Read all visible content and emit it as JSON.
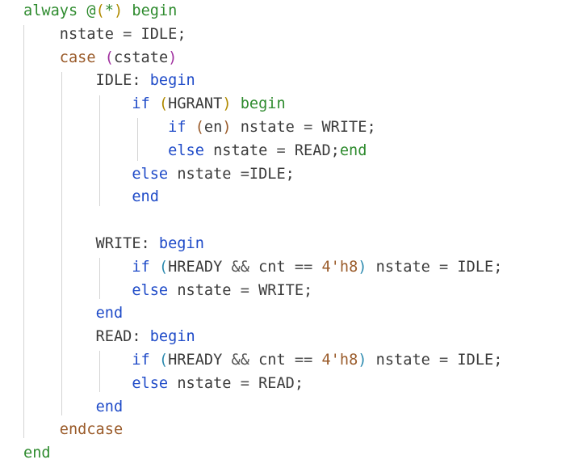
{
  "code": {
    "lines": [
      [
        {
          "t": "always ",
          "c": "kw-green"
        },
        {
          "t": "@",
          "c": "kw-green"
        },
        {
          "t": "(",
          "c": "paren-gold"
        },
        {
          "t": "*",
          "c": "kw-green"
        },
        {
          "t": ")",
          "c": "paren-gold"
        },
        {
          "t": " begin",
          "c": "kw-green"
        }
      ],
      [
        {
          "t": "    nstate ",
          "c": "plain"
        },
        {
          "t": "=",
          "c": "op"
        },
        {
          "t": " IDLE;",
          "c": "plain"
        }
      ],
      [
        {
          "t": "    ",
          "c": "plain"
        },
        {
          "t": "case",
          "c": "kw-brown"
        },
        {
          "t": " ",
          "c": "plain"
        },
        {
          "t": "(",
          "c": "paren-purple"
        },
        {
          "t": "cstate",
          "c": "plain"
        },
        {
          "t": ")",
          "c": "paren-purple"
        }
      ],
      [
        {
          "t": "        IDLE: ",
          "c": "plain"
        },
        {
          "t": "begin",
          "c": "kw-blue"
        }
      ],
      [
        {
          "t": "            ",
          "c": "plain"
        },
        {
          "t": "if",
          "c": "kw-blue"
        },
        {
          "t": " ",
          "c": "plain"
        },
        {
          "t": "(",
          "c": "paren-gold"
        },
        {
          "t": "HGRANT",
          "c": "plain"
        },
        {
          "t": ")",
          "c": "paren-gold"
        },
        {
          "t": " begin",
          "c": "kw-green"
        }
      ],
      [
        {
          "t": "                ",
          "c": "plain"
        },
        {
          "t": "if",
          "c": "kw-blue"
        },
        {
          "t": " ",
          "c": "plain"
        },
        {
          "t": "(",
          "c": "kw-brown"
        },
        {
          "t": "en",
          "c": "plain"
        },
        {
          "t": ")",
          "c": "kw-brown"
        },
        {
          "t": " nstate ",
          "c": "plain"
        },
        {
          "t": "=",
          "c": "op"
        },
        {
          "t": " WRITE;",
          "c": "plain"
        }
      ],
      [
        {
          "t": "                ",
          "c": "plain"
        },
        {
          "t": "else",
          "c": "kw-blue"
        },
        {
          "t": " nstate ",
          "c": "plain"
        },
        {
          "t": "=",
          "c": "op"
        },
        {
          "t": " READ;",
          "c": "plain"
        },
        {
          "t": "end",
          "c": "kw-green"
        }
      ],
      [
        {
          "t": "            ",
          "c": "plain"
        },
        {
          "t": "else",
          "c": "kw-blue"
        },
        {
          "t": " nstate ",
          "c": "plain"
        },
        {
          "t": "=",
          "c": "op"
        },
        {
          "t": "IDLE;",
          "c": "plain"
        }
      ],
      [
        {
          "t": "            ",
          "c": "plain"
        },
        {
          "t": "end",
          "c": "kw-blue"
        }
      ],
      [],
      [
        {
          "t": "        WRITE: ",
          "c": "plain"
        },
        {
          "t": "begin",
          "c": "kw-blue"
        }
      ],
      [
        {
          "t": "            ",
          "c": "plain"
        },
        {
          "t": "if",
          "c": "kw-blue"
        },
        {
          "t": " ",
          "c": "plain"
        },
        {
          "t": "(",
          "c": "paren-teal"
        },
        {
          "t": "HREADY ",
          "c": "plain"
        },
        {
          "t": "&&",
          "c": "op"
        },
        {
          "t": " cnt ",
          "c": "plain"
        },
        {
          "t": "==",
          "c": "op"
        },
        {
          "t": " ",
          "c": "plain"
        },
        {
          "t": "4'h8",
          "c": "num"
        },
        {
          "t": ")",
          "c": "paren-teal"
        },
        {
          "t": " nstate ",
          "c": "plain"
        },
        {
          "t": "=",
          "c": "op"
        },
        {
          "t": " IDLE;",
          "c": "plain"
        }
      ],
      [
        {
          "t": "            ",
          "c": "plain"
        },
        {
          "t": "else",
          "c": "kw-blue"
        },
        {
          "t": " nstate ",
          "c": "plain"
        },
        {
          "t": "=",
          "c": "op"
        },
        {
          "t": " WRITE;",
          "c": "plain"
        }
      ],
      [
        {
          "t": "        ",
          "c": "plain"
        },
        {
          "t": "end",
          "c": "kw-blue"
        }
      ],
      [
        {
          "t": "        READ: ",
          "c": "plain"
        },
        {
          "t": "begin",
          "c": "kw-blue"
        }
      ],
      [
        {
          "t": "            ",
          "c": "plain"
        },
        {
          "t": "if",
          "c": "kw-blue"
        },
        {
          "t": " ",
          "c": "plain"
        },
        {
          "t": "(",
          "c": "paren-teal"
        },
        {
          "t": "HREADY ",
          "c": "plain"
        },
        {
          "t": "&&",
          "c": "op"
        },
        {
          "t": " cnt ",
          "c": "plain"
        },
        {
          "t": "==",
          "c": "op"
        },
        {
          "t": " ",
          "c": "plain"
        },
        {
          "t": "4'h8",
          "c": "num"
        },
        {
          "t": ")",
          "c": "paren-teal"
        },
        {
          "t": " nstate ",
          "c": "plain"
        },
        {
          "t": "=",
          "c": "op"
        },
        {
          "t": " IDLE;",
          "c": "plain"
        }
      ],
      [
        {
          "t": "            ",
          "c": "plain"
        },
        {
          "t": "else",
          "c": "kw-blue"
        },
        {
          "t": " nstate ",
          "c": "plain"
        },
        {
          "t": "=",
          "c": "op"
        },
        {
          "t": " READ;",
          "c": "plain"
        }
      ],
      [
        {
          "t": "        ",
          "c": "plain"
        },
        {
          "t": "end",
          "c": "kw-blue"
        }
      ],
      [
        {
          "t": "    ",
          "c": "plain"
        },
        {
          "t": "endcase",
          "c": "kw-brown"
        }
      ],
      [
        {
          "t": "end",
          "c": "kw-green"
        }
      ]
    ]
  }
}
